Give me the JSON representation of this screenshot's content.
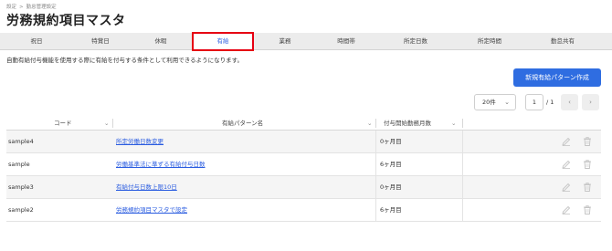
{
  "breadcrumb": {
    "items": [
      "設定",
      "勤怠管理設定"
    ],
    "separator": ">"
  },
  "page_title": "労務規約項目マスタ",
  "tabs": [
    {
      "label": "祝日",
      "active": false
    },
    {
      "label": "特賞日",
      "active": false
    },
    {
      "label": "休暇",
      "active": false
    },
    {
      "label": "有給",
      "active": true
    },
    {
      "label": "業務",
      "active": false
    },
    {
      "label": "時間帯",
      "active": false
    },
    {
      "label": "所定日数",
      "active": false
    },
    {
      "label": "所定時間",
      "active": false
    },
    {
      "label": "勤怠共有",
      "active": false
    }
  ],
  "description": "自動有給付与機能を使用する際に有給を付与する条件として利用できるようになります。",
  "new_button_label": "新規有給パターン作成",
  "pagination": {
    "per_page": "20件",
    "current_page": "1",
    "total_pages": "/ 1",
    "prev": "‹",
    "next": "›"
  },
  "table": {
    "columns": [
      "コード",
      "有給パターン名",
      "付与開始勤務月数"
    ],
    "rows": [
      {
        "code": "sample4",
        "name": "所定労働日数変更",
        "months": "0ヶ月目"
      },
      {
        "code": "sample",
        "name": "労働基準法に準ずる有給付与日数",
        "months": "6ヶ月目"
      },
      {
        "code": "sample3",
        "name": "有給付与日数上限10日",
        "months": "0ヶ月目"
      },
      {
        "code": "sample2",
        "name": "労務規約項目マスタで設定",
        "months": "6ヶ月目"
      }
    ]
  },
  "colors": {
    "accent": "#2f6de1",
    "link": "#2a5ce0",
    "active_tab_border": "#e60012"
  }
}
